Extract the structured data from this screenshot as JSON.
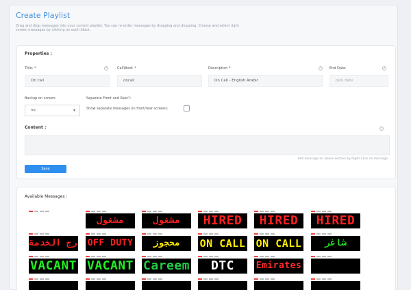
{
  "page": {
    "title": "Create Playlist",
    "description": "Drag and drop messages into your current playlist. You can re-order messages by dragging and dropping. Choose and select right screen messages by clicking on each block."
  },
  "properties": {
    "heading": "Properties :",
    "title_label": "Title: *",
    "title_value": "On call",
    "callword_label": "CallWord: *",
    "callword_value": "oncall",
    "description_label": "Description *",
    "description_value": "On Call - English Arabic",
    "enddate_label": "End Date:",
    "enddate_placeholder": "pick date",
    "backup_label": "Backup on screen:",
    "backup_value": "no",
    "separate_label": "Separate Front and Rear?:",
    "separate_checkbox_label": "Show separate messages on front/rear screens:",
    "content_label": "Content :",
    "content_hint": "Add message on above section by Right Click on message",
    "save_label": "Save"
  },
  "available": {
    "heading": "Available Messages :",
    "messages": [
      {
        "text": "",
        "color": "#ffffff",
        "bg": "#ffffff",
        "empty": true
      },
      {
        "text": "مشغول",
        "color": "#ff2020"
      },
      {
        "text": "مشغول",
        "color": "#ff2020"
      },
      {
        "text": "HIRED",
        "color": "#ff2020"
      },
      {
        "text": "HIRED",
        "color": "#ff2020"
      },
      {
        "text": "HIRED",
        "color": "#ff2020"
      },
      {
        "text": "خارج الخدمة",
        "color": "#ff2020"
      },
      {
        "text": "OFF DUTY",
        "color": "#ff2020"
      },
      {
        "text": "محجوز",
        "color": "#ffee00"
      },
      {
        "text": "ON CALL",
        "color": "#ffee00"
      },
      {
        "text": "ON CALL",
        "color": "#ffee00"
      },
      {
        "text": "شاغر",
        "color": "#22dd22"
      },
      {
        "text": "VACANT",
        "color": "#22ee22"
      },
      {
        "text": "VACANT",
        "color": "#22ee22"
      },
      {
        "text": "Careem",
        "color": "#22cc44"
      },
      {
        "text": "DTC",
        "color": "#ffffff"
      },
      {
        "text": "Emirates",
        "color": "#ff2a2a"
      },
      {
        "text": "",
        "color": "#22cc22"
      },
      {
        "text": "",
        "color": "#ffffff"
      },
      {
        "text": "",
        "color": "#ffffff"
      },
      {
        "text": "",
        "color": "#ffffff"
      },
      {
        "text": "",
        "color": "#ffffff"
      },
      {
        "text": "",
        "color": "#ffffff"
      },
      {
        "text": "",
        "color": "#ffffff"
      }
    ]
  },
  "colors": {
    "accent": "#2f8ff0",
    "title": "#3a8dde",
    "led_red": "#ff2020",
    "led_yellow": "#ffee00",
    "led_green": "#22ee22"
  }
}
